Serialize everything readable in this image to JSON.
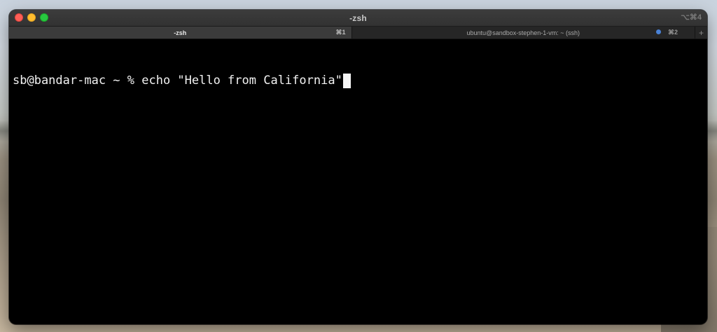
{
  "window": {
    "title": "-zsh",
    "title_shortcut": "⌥⌘4"
  },
  "tabs": [
    {
      "label": "-zsh",
      "shortcut": "⌘1",
      "active": true
    },
    {
      "label": "ubuntu@sandbox-stephen-1-vm: ~ (ssh)",
      "shortcut": "⌘2",
      "active": false,
      "activity_indicator": true
    }
  ],
  "new_tab_label": "+",
  "terminal": {
    "prompt": "sb@bandar-mac ~ % ",
    "command": "echo \"Hello from California\""
  },
  "icons": {
    "close": "close-icon",
    "minimize": "minimize-icon",
    "maximize": "maximize-icon",
    "new_tab": "plus-icon"
  },
  "colors": {
    "close": "#fe5f57",
    "minimize": "#febc2e",
    "maximize": "#28c840",
    "activity_dot": "#4a82d6",
    "terminal_bg": "#000000",
    "terminal_fg": "#f2f2f2"
  }
}
